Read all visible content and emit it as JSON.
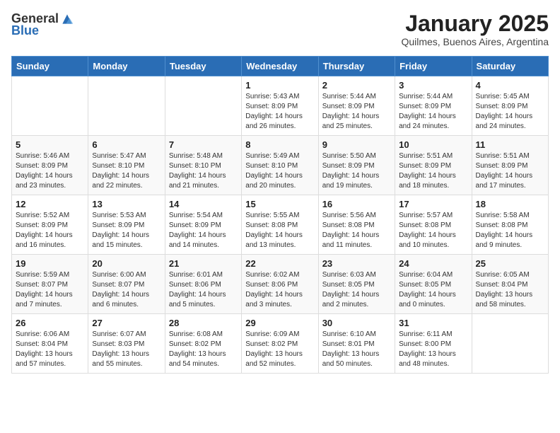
{
  "logo": {
    "general": "General",
    "blue": "Blue"
  },
  "header": {
    "month": "January 2025",
    "location": "Quilmes, Buenos Aires, Argentina"
  },
  "weekdays": [
    "Sunday",
    "Monday",
    "Tuesday",
    "Wednesday",
    "Thursday",
    "Friday",
    "Saturday"
  ],
  "weeks": [
    [
      {
        "day": "",
        "info": ""
      },
      {
        "day": "",
        "info": ""
      },
      {
        "day": "",
        "info": ""
      },
      {
        "day": "1",
        "info": "Sunrise: 5:43 AM\nSunset: 8:09 PM\nDaylight: 14 hours\nand 26 minutes."
      },
      {
        "day": "2",
        "info": "Sunrise: 5:44 AM\nSunset: 8:09 PM\nDaylight: 14 hours\nand 25 minutes."
      },
      {
        "day": "3",
        "info": "Sunrise: 5:44 AM\nSunset: 8:09 PM\nDaylight: 14 hours\nand 24 minutes."
      },
      {
        "day": "4",
        "info": "Sunrise: 5:45 AM\nSunset: 8:09 PM\nDaylight: 14 hours\nand 24 minutes."
      }
    ],
    [
      {
        "day": "5",
        "info": "Sunrise: 5:46 AM\nSunset: 8:09 PM\nDaylight: 14 hours\nand 23 minutes."
      },
      {
        "day": "6",
        "info": "Sunrise: 5:47 AM\nSunset: 8:10 PM\nDaylight: 14 hours\nand 22 minutes."
      },
      {
        "day": "7",
        "info": "Sunrise: 5:48 AM\nSunset: 8:10 PM\nDaylight: 14 hours\nand 21 minutes."
      },
      {
        "day": "8",
        "info": "Sunrise: 5:49 AM\nSunset: 8:10 PM\nDaylight: 14 hours\nand 20 minutes."
      },
      {
        "day": "9",
        "info": "Sunrise: 5:50 AM\nSunset: 8:09 PM\nDaylight: 14 hours\nand 19 minutes."
      },
      {
        "day": "10",
        "info": "Sunrise: 5:51 AM\nSunset: 8:09 PM\nDaylight: 14 hours\nand 18 minutes."
      },
      {
        "day": "11",
        "info": "Sunrise: 5:51 AM\nSunset: 8:09 PM\nDaylight: 14 hours\nand 17 minutes."
      }
    ],
    [
      {
        "day": "12",
        "info": "Sunrise: 5:52 AM\nSunset: 8:09 PM\nDaylight: 14 hours\nand 16 minutes."
      },
      {
        "day": "13",
        "info": "Sunrise: 5:53 AM\nSunset: 8:09 PM\nDaylight: 14 hours\nand 15 minutes."
      },
      {
        "day": "14",
        "info": "Sunrise: 5:54 AM\nSunset: 8:09 PM\nDaylight: 14 hours\nand 14 minutes."
      },
      {
        "day": "15",
        "info": "Sunrise: 5:55 AM\nSunset: 8:08 PM\nDaylight: 14 hours\nand 13 minutes."
      },
      {
        "day": "16",
        "info": "Sunrise: 5:56 AM\nSunset: 8:08 PM\nDaylight: 14 hours\nand 11 minutes."
      },
      {
        "day": "17",
        "info": "Sunrise: 5:57 AM\nSunset: 8:08 PM\nDaylight: 14 hours\nand 10 minutes."
      },
      {
        "day": "18",
        "info": "Sunrise: 5:58 AM\nSunset: 8:08 PM\nDaylight: 14 hours\nand 9 minutes."
      }
    ],
    [
      {
        "day": "19",
        "info": "Sunrise: 5:59 AM\nSunset: 8:07 PM\nDaylight: 14 hours\nand 7 minutes."
      },
      {
        "day": "20",
        "info": "Sunrise: 6:00 AM\nSunset: 8:07 PM\nDaylight: 14 hours\nand 6 minutes."
      },
      {
        "day": "21",
        "info": "Sunrise: 6:01 AM\nSunset: 8:06 PM\nDaylight: 14 hours\nand 5 minutes."
      },
      {
        "day": "22",
        "info": "Sunrise: 6:02 AM\nSunset: 8:06 PM\nDaylight: 14 hours\nand 3 minutes."
      },
      {
        "day": "23",
        "info": "Sunrise: 6:03 AM\nSunset: 8:05 PM\nDaylight: 14 hours\nand 2 minutes."
      },
      {
        "day": "24",
        "info": "Sunrise: 6:04 AM\nSunset: 8:05 PM\nDaylight: 14 hours\nand 0 minutes."
      },
      {
        "day": "25",
        "info": "Sunrise: 6:05 AM\nSunset: 8:04 PM\nDaylight: 13 hours\nand 58 minutes."
      }
    ],
    [
      {
        "day": "26",
        "info": "Sunrise: 6:06 AM\nSunset: 8:04 PM\nDaylight: 13 hours\nand 57 minutes."
      },
      {
        "day": "27",
        "info": "Sunrise: 6:07 AM\nSunset: 8:03 PM\nDaylight: 13 hours\nand 55 minutes."
      },
      {
        "day": "28",
        "info": "Sunrise: 6:08 AM\nSunset: 8:02 PM\nDaylight: 13 hours\nand 54 minutes."
      },
      {
        "day": "29",
        "info": "Sunrise: 6:09 AM\nSunset: 8:02 PM\nDaylight: 13 hours\nand 52 minutes."
      },
      {
        "day": "30",
        "info": "Sunrise: 6:10 AM\nSunset: 8:01 PM\nDaylight: 13 hours\nand 50 minutes."
      },
      {
        "day": "31",
        "info": "Sunrise: 6:11 AM\nSunset: 8:00 PM\nDaylight: 13 hours\nand 48 minutes."
      },
      {
        "day": "",
        "info": ""
      }
    ]
  ]
}
